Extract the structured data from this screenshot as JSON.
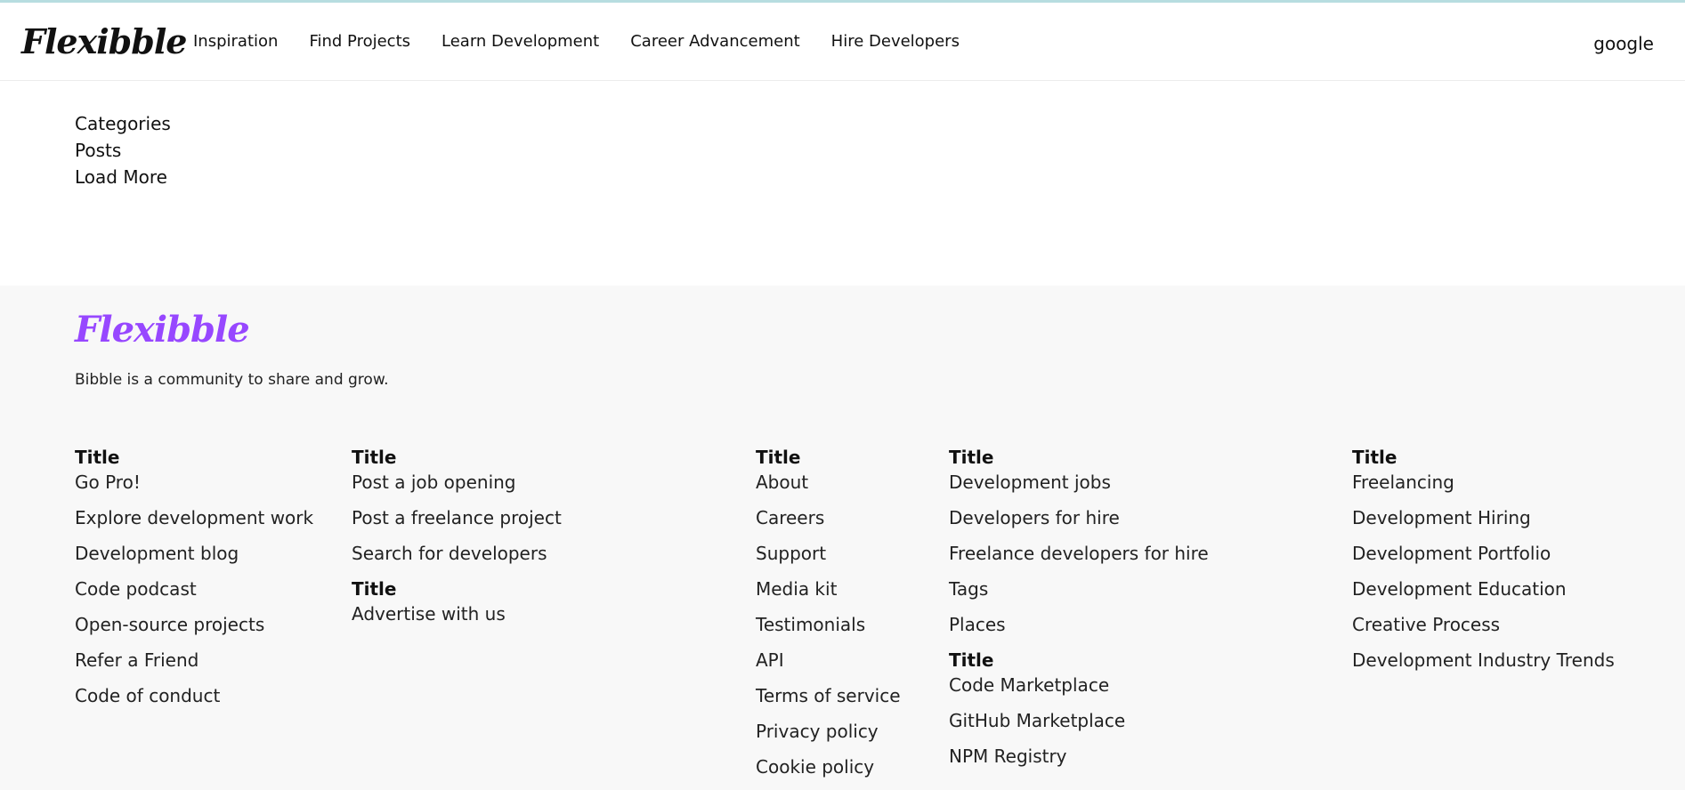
{
  "header": {
    "logo": "Flexibble",
    "nav": [
      "Inspiration",
      "Find Projects",
      "Learn Development",
      "Career Advancement",
      "Hire Developers"
    ],
    "right_link": "google"
  },
  "main": {
    "items": [
      "Categories",
      "Posts",
      "Load More"
    ]
  },
  "footer": {
    "logo": "Flexibble",
    "tagline": "Bibble is a community to share and grow.",
    "columns": [
      {
        "title": "Title",
        "links": [
          "Go Pro!",
          "Explore development work",
          "Development blog",
          "Code podcast",
          "Open-source projects",
          "Refer a Friend",
          "Code of conduct"
        ]
      },
      {
        "title": "Title",
        "links": [
          "Post a job opening",
          "Post a freelance project",
          "Search for developers"
        ],
        "sub_title": "Title",
        "sub_links": [
          "Advertise with us"
        ]
      },
      {
        "title": "Title",
        "links": [
          "About",
          "Careers",
          "Support",
          "Media kit",
          "Testimonials",
          "API",
          "Terms of service",
          "Privacy policy",
          "Cookie policy"
        ]
      },
      {
        "title": "Title",
        "links": [
          "Development jobs",
          "Developers for hire",
          "Freelance developers for hire",
          "Tags",
          "Places"
        ],
        "sub_title": "Title",
        "sub_links": [
          "Code Marketplace",
          "GitHub Marketplace",
          "NPM Registry"
        ]
      },
      {
        "title": "Title",
        "links": [
          "Freelancing",
          "Development Hiring",
          "Development Portfolio",
          "Development Education",
          "Creative Process",
          "Development Industry Trends"
        ]
      }
    ]
  },
  "colors": {
    "accent": "#9747ff",
    "footer_bg": "#f8f8f8",
    "top_line": "#b7dde0"
  }
}
